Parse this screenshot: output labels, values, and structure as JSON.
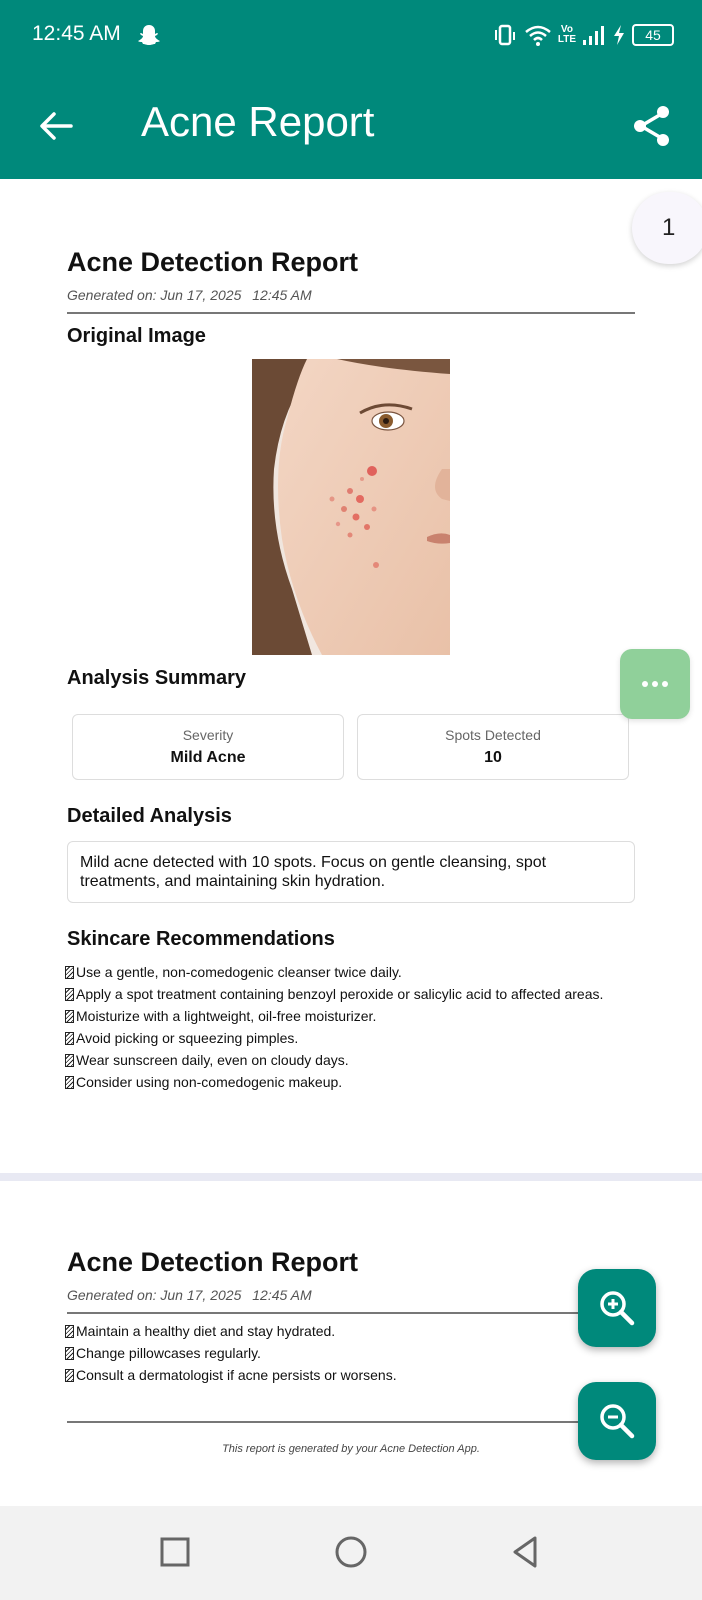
{
  "status_bar": {
    "time": "12:45 AM",
    "volte": "Vo\nLTE",
    "battery": "45"
  },
  "app_bar": {
    "title": "Acne Report"
  },
  "page_indicator": "1",
  "page1": {
    "report_title": "Acne Detection Report",
    "generated": "Generated on: Jun 17, 2025  12:45 AM",
    "original_image_heading": "Original Image",
    "analysis_summary_heading": "Analysis Summary",
    "severity_label": "Severity",
    "severity_value": "Mild Acne",
    "spots_label": "Spots Detected",
    "spots_value": "10",
    "detailed_heading": "Detailed Analysis",
    "detailed_text": "Mild acne detected with 10 spots. Focus on gentle cleansing, spot treatments, and maintaining skin hydration.",
    "recommendations_heading": "Skincare Recommendations",
    "recommendations": [
      "Use a gentle, non-comedogenic cleanser twice daily.",
      "Apply a spot treatment containing benzoyl peroxide or salicylic acid to affected areas.",
      "Moisturize with a lightweight, oil-free moisturizer.",
      "Avoid picking or squeezing pimples.",
      "Wear sunscreen daily, even on cloudy days.",
      "Consider using non-comedogenic makeup."
    ]
  },
  "page2": {
    "report_title": "Acne Detection Report",
    "generated": "Generated on: Jun 17, 2025  12:45 AM",
    "recommendations": [
      "Maintain a healthy diet and stay hydrated.",
      "Change pillowcases regularly.",
      "Consult a dermatologist if acne persists or worsens."
    ],
    "footer": "This report is generated by your Acne Detection App."
  },
  "colors": {
    "primary": "#00897b",
    "more_fab": "#90d09a",
    "separator": "#e8e9f3"
  },
  "icons": {
    "back": "arrow-left-icon",
    "share": "share-icon",
    "more": "more-horizontal-icon",
    "zoom_in": "zoom-in-icon",
    "zoom_out": "zoom-out-icon"
  }
}
